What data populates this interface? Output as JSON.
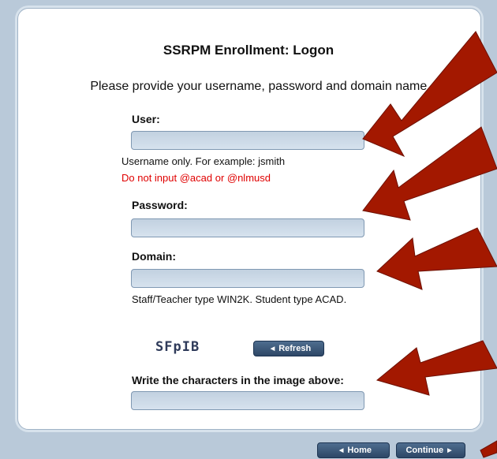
{
  "page": {
    "title": "SSRPM Enrollment: Logon",
    "intro": "Please provide your username, password and domain name."
  },
  "form": {
    "user_label": "User:",
    "user_hint": "Username only. For example: jsmith",
    "user_warning": "Do not input @acad or @nlmusd",
    "password_label": "Password:",
    "domain_label": "Domain:",
    "domain_hint": "Staff/Teacher type WIN2K. Student type ACAD.",
    "captcha_text": "SFpIB",
    "refresh_label": "Refresh",
    "captcha_label": "Write the characters in the image above:"
  },
  "buttons": {
    "home_label": "Home",
    "continue_label": "Continue"
  },
  "colors": {
    "accent": "#2d4766",
    "warning": "#e00000",
    "arrow": "#a31800"
  }
}
